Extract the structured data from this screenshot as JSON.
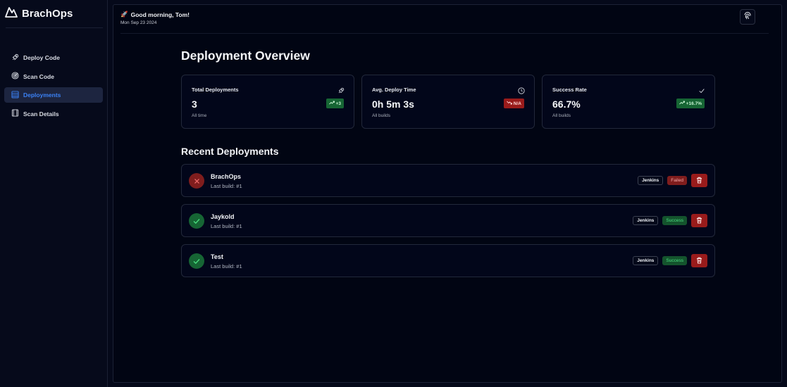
{
  "brand": {
    "name": "BrachOps",
    "logo_icon": "mountain-logo-icon"
  },
  "sidebar": {
    "items": [
      {
        "label": "Deploy Code",
        "icon": "rocket-icon",
        "active": false
      },
      {
        "label": "Scan Code",
        "icon": "radar-icon",
        "active": false
      },
      {
        "label": "Deployments",
        "icon": "list-icon",
        "active": true
      },
      {
        "label": "Scan Details",
        "icon": "film-icon",
        "active": false
      }
    ]
  },
  "header": {
    "emoji": "🚀",
    "greeting": "Good morning, Tom!",
    "date": "Mon Sep 23 2024",
    "action_icon": "fingerprint-icon"
  },
  "main": {
    "title": "Deployment Overview",
    "stats": [
      {
        "label": "Total Deployments",
        "value": "3",
        "sub": "All time",
        "icon": "rocket-icon",
        "badge": "+3",
        "badge_trend": "up",
        "badge_color": "#166534"
      },
      {
        "label": "Avg. Deploy Time",
        "value": "0h 5m 3s",
        "sub": "All builds",
        "icon": "clock-icon",
        "badge": "N/A",
        "badge_trend": "down",
        "badge_color": "#991b1b"
      },
      {
        "label": "Success Rate",
        "value": "66.7%",
        "sub": "All builds",
        "icon": "check-icon",
        "badge": "+16.7%",
        "badge_trend": "up",
        "badge_color": "#166534"
      }
    ],
    "recent_title": "Recent Deployments",
    "deployments": [
      {
        "name": "BrachOps",
        "sub": "Last build: #1",
        "tool": "Jenkins",
        "status": "Failed",
        "ok": false
      },
      {
        "name": "Jaykold",
        "sub": "Last build: #1",
        "tool": "Jenkins",
        "status": "Success",
        "ok": true
      },
      {
        "name": "Test",
        "sub": "Last build: #1",
        "tool": "Jenkins",
        "status": "Success",
        "ok": true
      }
    ]
  },
  "colors": {
    "accent": "#3b82f6",
    "success": "#166534",
    "danger": "#991b1b",
    "background": "#010513"
  }
}
